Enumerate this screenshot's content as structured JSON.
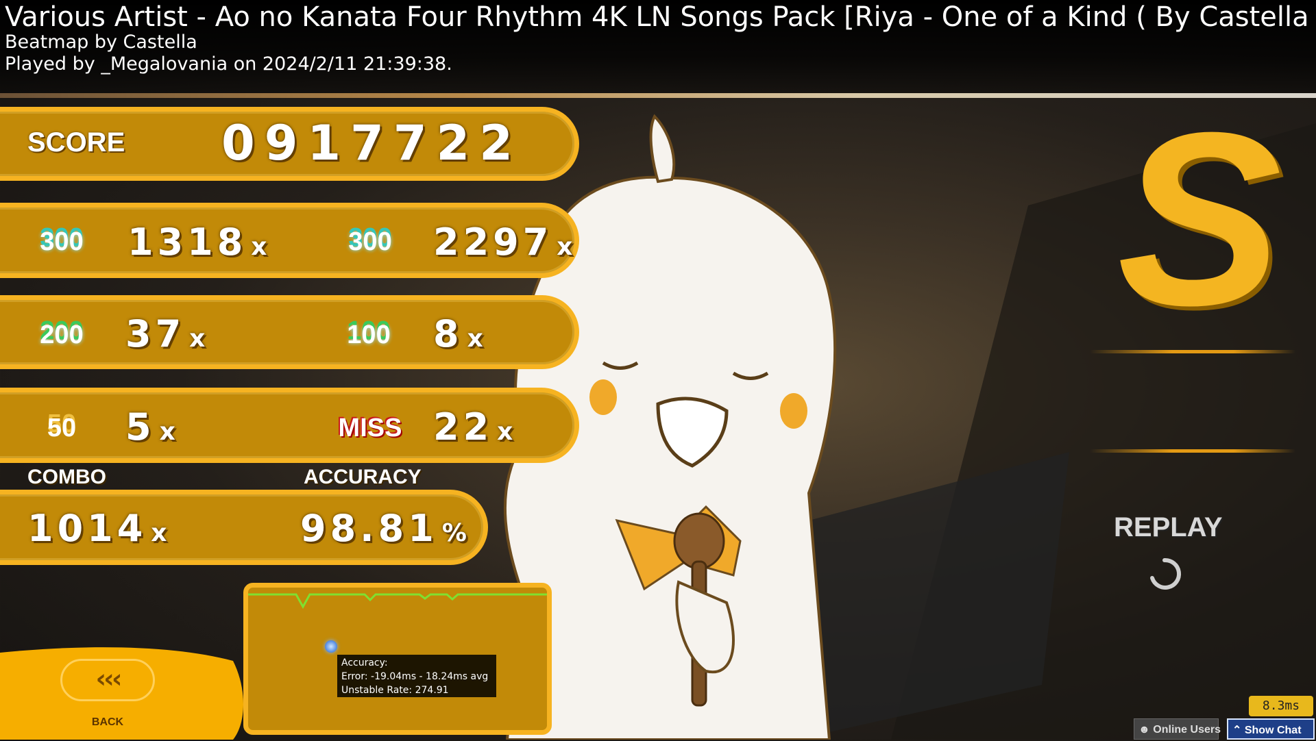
{
  "header": {
    "title": "Various Artist - Ao no Kanata Four Rhythm 4K LN Songs Pack [Riya - One of a Kind ( By Castella )]",
    "beatmap_by": "Beatmap by Castella",
    "played_by": "Played by _Megalovania on 2024/2/11 21:39:38."
  },
  "score": {
    "label": "SCORE",
    "value": "0917722"
  },
  "judgements": {
    "row1": {
      "left_icon": "300",
      "left_count": "1318",
      "right_icon": "300",
      "right_count": "2297"
    },
    "row2": {
      "left_icon": "200",
      "left_count": "37",
      "right_icon": "100",
      "right_count": "8"
    },
    "row3": {
      "left_icon": "50",
      "left_count": "5",
      "right_icon": "MISS",
      "right_count": "22"
    },
    "x_suffix": "x"
  },
  "combo": {
    "label": "COMBO",
    "value": "1014",
    "suffix": "x"
  },
  "accuracy": {
    "label": "ACCURACY",
    "value": "98.81",
    "suffix": "%"
  },
  "tooltip": {
    "line1": "Accuracy:",
    "line2": "Error: -19.04ms - 18.24ms avg",
    "line3": "Unstable Rate: 274.91"
  },
  "back": {
    "arrows": "‹‹‹",
    "label": "BACK"
  },
  "rank": {
    "letter": "S"
  },
  "replay": {
    "label": "REPLAY"
  },
  "footer": {
    "frame_time": "8.3ms",
    "online_users": "Online Users",
    "show_chat": "Show Chat"
  },
  "colors": {
    "panel": "#c28a08",
    "panel_border": "#f6b321",
    "rank": "#f4b521",
    "graph_line": "#7fe030"
  }
}
